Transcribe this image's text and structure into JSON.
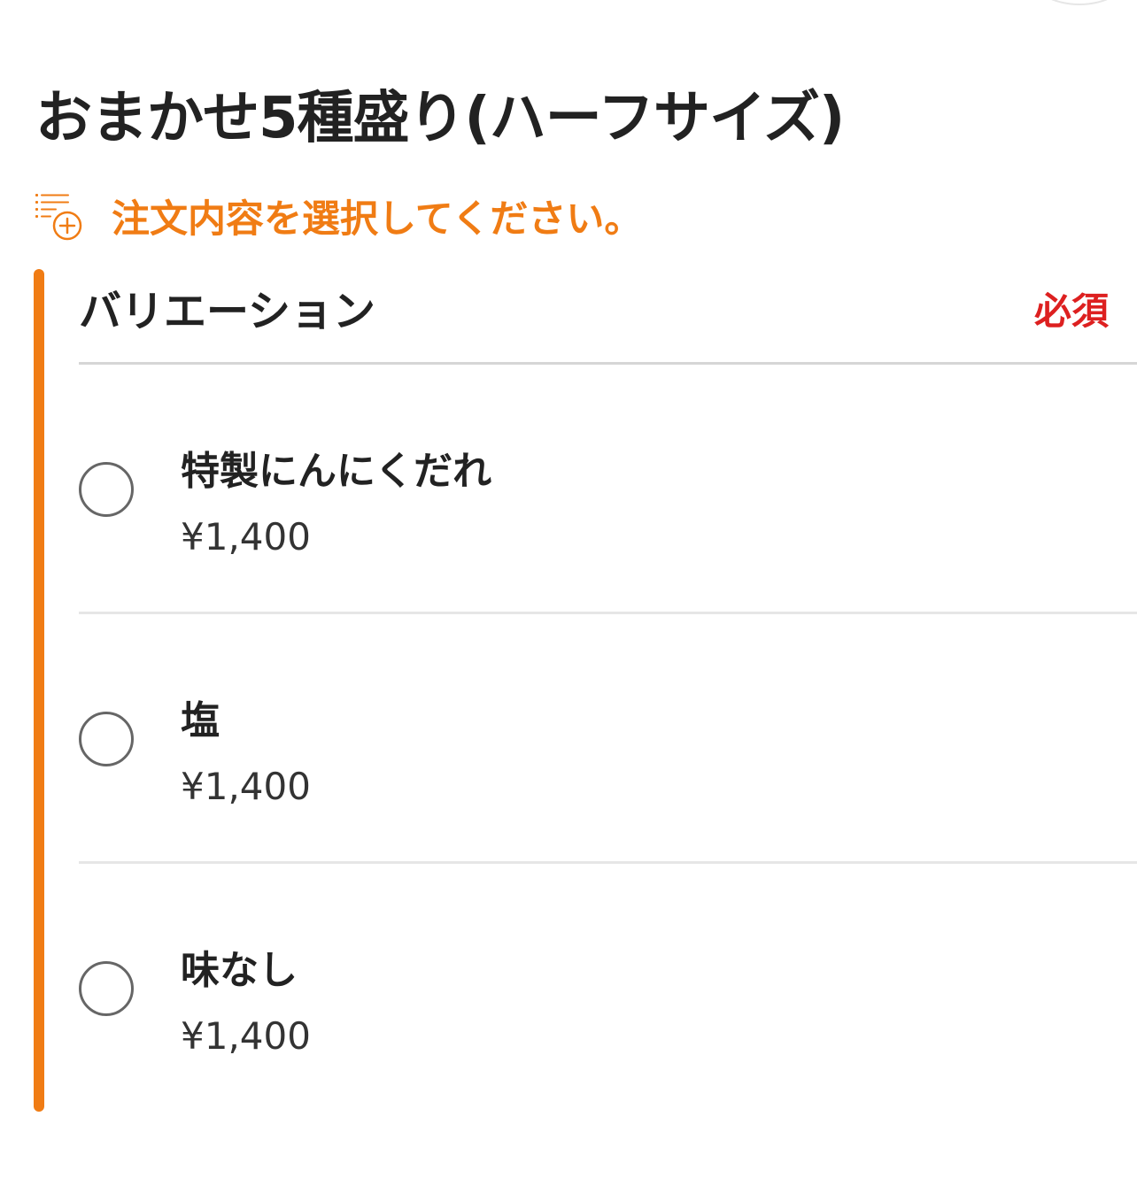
{
  "item": {
    "title": "おまかせ5種盛り(ハーフサイズ)"
  },
  "notice": {
    "icon": "list-add-icon",
    "text": "注文内容を選択してください。",
    "color": "#f07c14"
  },
  "section": {
    "title": "バリエーション",
    "required_label": "必須",
    "required_color": "#dd2020",
    "accent_color": "#f07c14",
    "options": [
      {
        "name": "特製にんにくだれ",
        "price": "¥1,400",
        "selected": false
      },
      {
        "name": "塩",
        "price": "¥1,400",
        "selected": false
      },
      {
        "name": "味なし",
        "price": "¥1,400",
        "selected": false
      }
    ]
  }
}
